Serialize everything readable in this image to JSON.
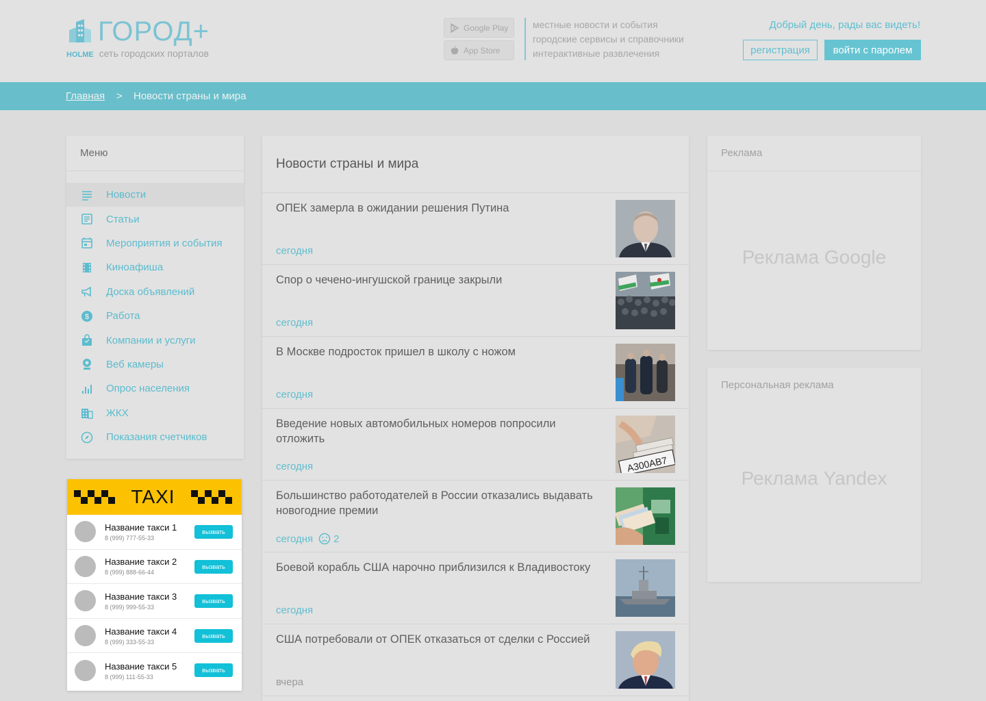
{
  "header": {
    "logo_text": "ГОРОД+",
    "logo_brand": "HOLME",
    "logo_subtitle": "сеть городских порталов",
    "google_play": "Google Play",
    "app_store": "App Store",
    "taglines": [
      "местные новости и события",
      "городские сервисы и справочники",
      "интерактивные развлечения"
    ],
    "greeting": "Добрый день, рады вас видеть!",
    "register_label": "регистрация",
    "login_label": "войти с паролем"
  },
  "breadcrumb": {
    "home": "Главная",
    "separator": ">",
    "current": "Новости страны и мира"
  },
  "menu": {
    "title": "Меню",
    "items": [
      {
        "label": "Новости",
        "icon": "list-icon"
      },
      {
        "label": "Статьи",
        "icon": "article-icon"
      },
      {
        "label": "Мероприятия и события",
        "icon": "calendar-icon"
      },
      {
        "label": "Киноафиша",
        "icon": "film-icon"
      },
      {
        "label": "Доска объявлений",
        "icon": "megaphone-icon"
      },
      {
        "label": "Работа",
        "icon": "dollar-icon"
      },
      {
        "label": "Компании и услуги",
        "icon": "bag-icon"
      },
      {
        "label": "Веб камеры",
        "icon": "webcam-icon"
      },
      {
        "label": "Опрос населения",
        "icon": "poll-icon"
      },
      {
        "label": "ЖКХ",
        "icon": "building-icon"
      },
      {
        "label": "Показания счетчиков",
        "icon": "gauge-icon"
      }
    ]
  },
  "taxi": {
    "title": "TAXI",
    "call_label": "вызвать",
    "items": [
      {
        "name": "Название такси 1",
        "phone": "8 (999) 777-55-33"
      },
      {
        "name": "Название такси 2",
        "phone": "8 (999) 888-66-44"
      },
      {
        "name": "Название такси 3",
        "phone": "8 (999) 999-55-33"
      },
      {
        "name": "Название такси 4",
        "phone": "8 (999) 333-55-33"
      },
      {
        "name": "Название такси 5",
        "phone": "8 (999) 111-55-33"
      }
    ]
  },
  "news": {
    "title": "Новости страны и мира",
    "items": [
      {
        "headline": "ОПЕК замерла в ожидании решения Путина",
        "date": "сегодня"
      },
      {
        "headline": "Спор о чечено-ингушской границе закрыли",
        "date": "сегодня"
      },
      {
        "headline": "В Москве подросток пришел в школу с ножом",
        "date": "сегодня"
      },
      {
        "headline": "Введение новых автомобильных номеров попросили отложить",
        "date": "сегодня",
        "plate": "А300АВ7"
      },
      {
        "headline": "Большинство работодателей в России отказались выдавать новогодние премии",
        "date": "сегодня",
        "comments": "2"
      },
      {
        "headline": "Боевой корабль США нарочно приблизился к Владивостоку",
        "date": "сегодня"
      },
      {
        "headline": "США потребовали от ОПЕК отказаться от сделки с Россией",
        "date": "вчера"
      }
    ]
  },
  "ads": {
    "block1_title": "Реклама",
    "block1_text": "Реклама Google",
    "block2_title": "Персональная реклама",
    "block2_text": "Реклама Yandex"
  },
  "colors": {
    "accent": "#5ebfd2",
    "breadcrumb_bar": "#68bfcb",
    "taxi_yellow": "#fcc202",
    "call_button": "#12c0d8"
  }
}
